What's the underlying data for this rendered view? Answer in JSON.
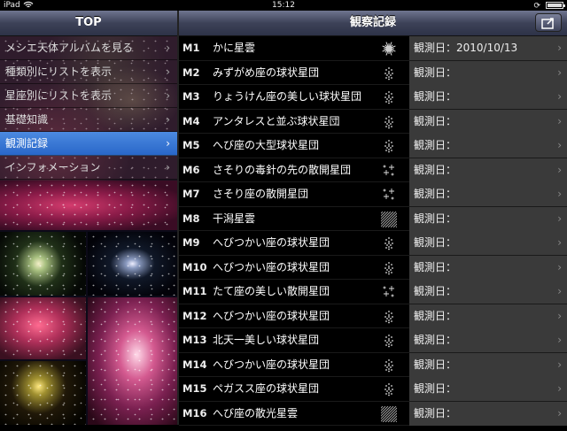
{
  "status_bar": {
    "carrier": "iPad",
    "time": "15:12"
  },
  "left": {
    "title": "TOP",
    "menu": [
      {
        "label": "メシエ天体アルバムを見る",
        "selected": false
      },
      {
        "label": "種類別にリストを表示",
        "selected": false
      },
      {
        "label": "星座別にリストを表示",
        "selected": false
      },
      {
        "label": "基礎知識",
        "selected": false
      },
      {
        "label": "観測記録",
        "selected": true
      },
      {
        "label": "インフォメーション",
        "selected": false
      }
    ],
    "chevron": "›"
  },
  "right": {
    "title": "観察記録",
    "chevron": "›",
    "rows": [
      {
        "id": "M1",
        "name": "かに星雲",
        "type_icon": "supernova-remnant-icon",
        "obs_label": "観測日：",
        "obs_date": "2010/10/13"
      },
      {
        "id": "M2",
        "name": "みずがめ座の球状星団",
        "type_icon": "globular-cluster-icon",
        "obs_label": "観測日：",
        "obs_date": ""
      },
      {
        "id": "M3",
        "name": "りょうけん座の美しい球状星団",
        "type_icon": "globular-cluster-icon",
        "obs_label": "観測日：",
        "obs_date": ""
      },
      {
        "id": "M4",
        "name": "アンタレスと並ぶ球状星団",
        "type_icon": "globular-cluster-icon",
        "obs_label": "観測日：",
        "obs_date": ""
      },
      {
        "id": "M5",
        "name": "へび座の大型球状星団",
        "type_icon": "globular-cluster-icon",
        "obs_label": "観測日：",
        "obs_date": ""
      },
      {
        "id": "M6",
        "name": "さそりの毒針の先の散開星団",
        "type_icon": "open-cluster-icon",
        "obs_label": "観測日：",
        "obs_date": ""
      },
      {
        "id": "M7",
        "name": "さそり座の散開星団",
        "type_icon": "open-cluster-icon",
        "obs_label": "観測日：",
        "obs_date": ""
      },
      {
        "id": "M8",
        "name": "干潟星雲",
        "type_icon": "nebula-icon",
        "obs_label": "観測日：",
        "obs_date": ""
      },
      {
        "id": "M9",
        "name": "へびつかい座の球状星団",
        "type_icon": "globular-cluster-icon",
        "obs_label": "観測日：",
        "obs_date": ""
      },
      {
        "id": "M10",
        "name": "へびつかい座の球状星団",
        "type_icon": "globular-cluster-icon",
        "obs_label": "観測日：",
        "obs_date": ""
      },
      {
        "id": "M11",
        "name": "たて座の美しい散開星団",
        "type_icon": "open-cluster-icon",
        "obs_label": "観測日：",
        "obs_date": ""
      },
      {
        "id": "M12",
        "name": "へびつかい座の球状星団",
        "type_icon": "globular-cluster-icon",
        "obs_label": "観測日：",
        "obs_date": ""
      },
      {
        "id": "M13",
        "name": "北天一美しい球状星団",
        "type_icon": "globular-cluster-icon",
        "obs_label": "観測日：",
        "obs_date": ""
      },
      {
        "id": "M14",
        "name": "へびつかい座の球状星団",
        "type_icon": "globular-cluster-icon",
        "obs_label": "観測日：",
        "obs_date": ""
      },
      {
        "id": "M15",
        "name": "ペガスス座の球状星団",
        "type_icon": "globular-cluster-icon",
        "obs_label": "観測日：",
        "obs_date": ""
      },
      {
        "id": "M16",
        "name": "へび座の散光星雲",
        "type_icon": "nebula-icon",
        "obs_label": "観測日：",
        "obs_date": ""
      }
    ]
  }
}
